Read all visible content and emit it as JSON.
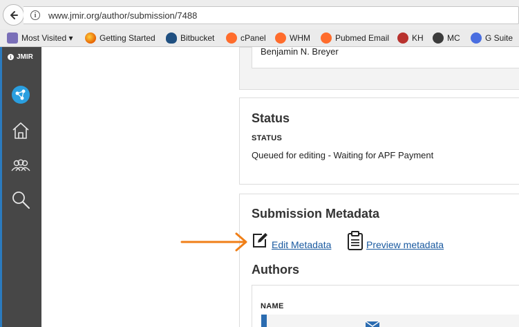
{
  "browser": {
    "url": "www.jmir.org/author/submission/7488",
    "bookmarks": [
      {
        "label": "Most Visited ▾",
        "icon": "folder-icon"
      },
      {
        "label": "Getting Started",
        "icon": "firefox-icon"
      },
      {
        "label": "Bitbucket",
        "icon": "bitbucket-icon"
      },
      {
        "label": "cPanel",
        "icon": "cpanel-icon"
      },
      {
        "label": "WHM",
        "icon": "cpanel-icon"
      },
      {
        "label": "Pubmed Email",
        "icon": "cpanel-icon"
      },
      {
        "label": "KH",
        "icon": "kh-icon"
      },
      {
        "label": "MC",
        "icon": "mailchimp-icon"
      },
      {
        "label": "G Suite",
        "icon": "gsuite-icon"
      }
    ]
  },
  "sidebar": {
    "logo": "JMIR",
    "items": [
      "dashboard-icon",
      "home-icon",
      "users-icon",
      "search-icon"
    ]
  },
  "main": {
    "author_name": "Benjamin N. Breyer",
    "status": {
      "title": "Status",
      "label": "STATUS",
      "value": "Queued for editing - Waiting for APF Payment"
    },
    "metadata": {
      "title": "Submission Metadata",
      "edit_label": "Edit Metadata",
      "preview_label": "Preview metadata"
    },
    "authors": {
      "title": "Authors",
      "name_header": "NAME"
    }
  },
  "colors": {
    "accent": "#1a5aa0",
    "annotation_arrow": "#f07f17",
    "sidebar": "#474747"
  }
}
